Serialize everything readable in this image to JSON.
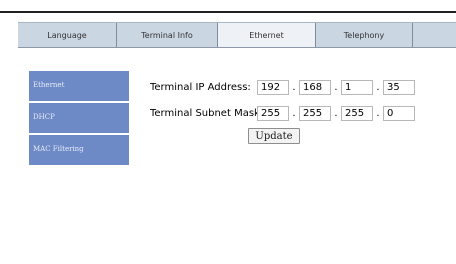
{
  "tabs": [
    {
      "label": "Language",
      "active": false
    },
    {
      "label": "Terminal Info",
      "active": false
    },
    {
      "label": "Ethernet",
      "active": true
    },
    {
      "label": "Telephony",
      "active": false
    },
    {
      "label": "",
      "active": false
    }
  ],
  "sidebar": {
    "items": [
      {
        "label": "Ethernet"
      },
      {
        "label": "DHCP"
      },
      {
        "label": "MAC Filtering"
      }
    ]
  },
  "form": {
    "ip": {
      "label": "Terminal IP Address:",
      "octets": [
        "192",
        "168",
        "1",
        "35"
      ]
    },
    "mask": {
      "label": "Terminal Subnet Mask:",
      "octets": [
        "255",
        "255",
        "255",
        "0"
      ]
    }
  },
  "update_label": "Update",
  "colors": {
    "tabbar": "#cbd6e3",
    "sidebar": "#6d8ac7"
  }
}
